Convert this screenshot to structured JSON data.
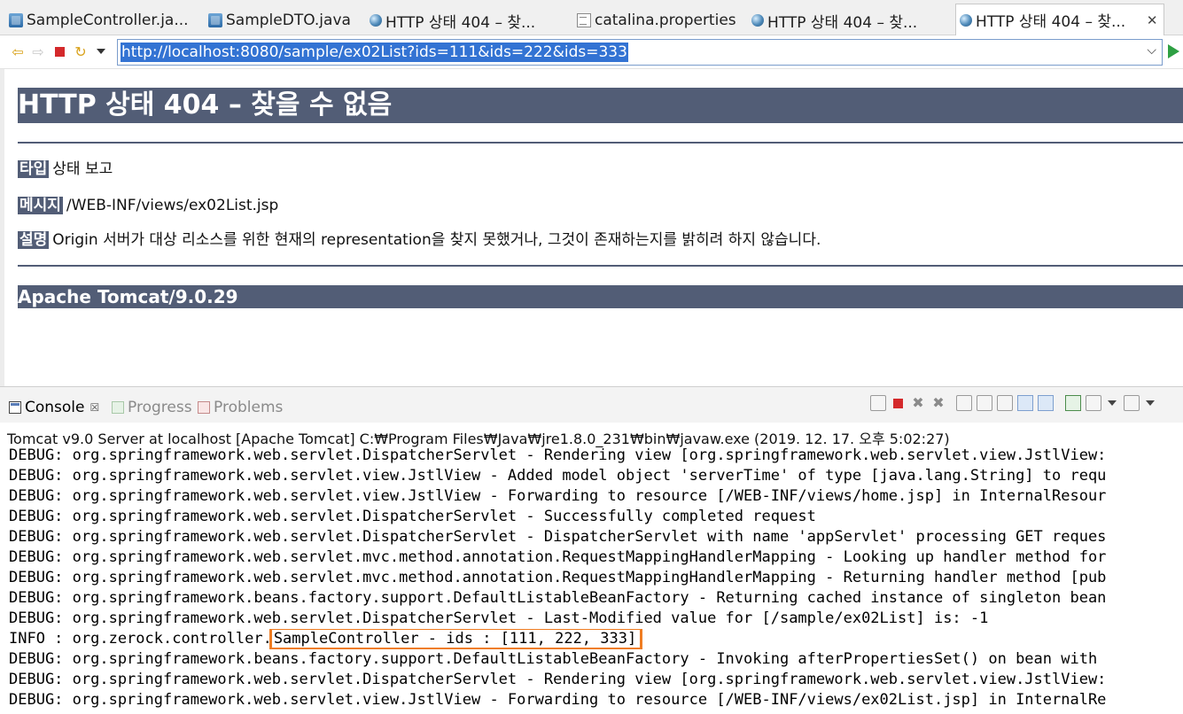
{
  "tabs": [
    {
      "label": "SampleController.ja...",
      "icon": "java-file-icon",
      "active": false
    },
    {
      "label": "SampleDTO.java",
      "icon": "java-file-icon",
      "active": false
    },
    {
      "label": "HTTP 상태 404 – 찾...",
      "icon": "globe-icon",
      "active": false
    },
    {
      "label": "catalina.properties",
      "icon": "properties-file-icon",
      "active": false
    },
    {
      "label": "HTTP 상태 404 – 찾...",
      "icon": "globe-icon",
      "active": false
    },
    {
      "label": "HTTP 상태 404 – 찾...",
      "icon": "globe-icon",
      "active": true,
      "close": "✕"
    }
  ],
  "browser": {
    "url": "http://localhost:8080/sample/ex02List?ids=111&ids=222&ids=333",
    "icons": [
      "back-arrow-icon",
      "forward-arrow-icon",
      "stop-icon",
      "refresh-icon",
      "menu-dropdown-icon",
      "url-dropdown-icon",
      "go-icon"
    ]
  },
  "page": {
    "title": "HTTP 상태 404 – 찾을 수 없음",
    "type_label": "타입",
    "type_value": "상태 보고",
    "message_label": "메시지",
    "message_value": "/WEB-INF/views/ex02List.jsp",
    "desc_label": "설명",
    "desc_value": "Origin 서버가 대상 리소스를 위한 현재의 representation을 찾지 못했거나, 그것이 존재하는지를 밝히려 하지 않습니다.",
    "footer": "Apache Tomcat/9.0.29"
  },
  "console": {
    "tabs": [
      {
        "label": "Console",
        "icon": "console-icon",
        "close": "☒"
      },
      {
        "label": "Progress",
        "icon": "progress-icon"
      },
      {
        "label": "Problems",
        "icon": "problems-icon"
      }
    ],
    "description": "Tomcat v9.0 Server at localhost [Apache Tomcat] C:₩Program Files₩Java₩jre1.8.0_231₩bin₩javaw.exe (2019. 12. 17. 오후 5:02:27)",
    "lines": [
      "DEBUG: org.springframework.web.servlet.DispatcherServlet - Rendering view [org.springframework.web.servlet.view.JstlView: ",
      "DEBUG: org.springframework.web.servlet.view.JstlView - Added model object 'serverTime' of type [java.lang.String] to requ",
      "DEBUG: org.springframework.web.servlet.view.JstlView - Forwarding to resource [/WEB-INF/views/home.jsp] in InternalResour",
      "DEBUG: org.springframework.web.servlet.DispatcherServlet - Successfully completed request",
      "DEBUG: org.springframework.web.servlet.DispatcherServlet - DispatcherServlet with name 'appServlet' processing GET reques",
      "DEBUG: org.springframework.web.servlet.mvc.method.annotation.RequestMappingHandlerMapping - Looking up handler method for",
      "DEBUG: org.springframework.web.servlet.mvc.method.annotation.RequestMappingHandlerMapping - Returning handler method [pub",
      "DEBUG: org.springframework.beans.factory.support.DefaultListableBeanFactory - Returning cached instance of singleton bean",
      "DEBUG: org.springframework.web.servlet.DispatcherServlet - Last-Modified value for [/sample/ex02List] is: -1"
    ],
    "info_prefix": "INFO : org.zerock.controller.",
    "info_highlight": "SampleController - ids : [111, 222, 333]",
    "lines_after": [
      "DEBUG: org.springframework.beans.factory.support.DefaultListableBeanFactory - Invoking afterPropertiesSet() on bean with ",
      "DEBUG: org.springframework.web.servlet.DispatcherServlet - Rendering view [org.springframework.web.servlet.view.JstlView: ",
      "DEBUG: org.springframework.web.servlet.view.JstlView - Forwarding to resource [/WEB-INF/views/ex02List.jsp] in InternalRe"
    ],
    "highlight_color": "#ef7d22"
  },
  "colors": {
    "tomcat_header": "#525d76",
    "url_selection": "#3373d3",
    "go_arrow": "#2ea043"
  }
}
